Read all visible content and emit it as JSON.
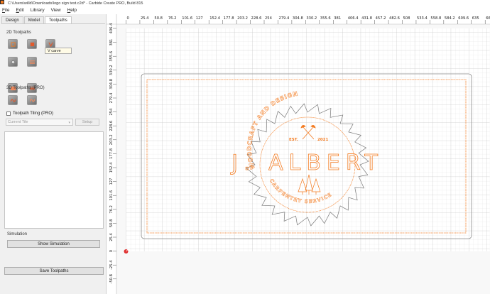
{
  "window": {
    "title": "C:\\Users\\willd\\Downloads\\logo sign test.c2d* - Carbide Create PRO, Build 815"
  },
  "menu": [
    {
      "key": "F",
      "rest": "ile"
    },
    {
      "key": "E",
      "rest": "dit"
    },
    {
      "key": "",
      "rest": "Library"
    },
    {
      "key": "",
      "rest": "View"
    },
    {
      "key": "H",
      "rest": "elp"
    }
  ],
  "tabs": [
    "Design",
    "Model",
    "Toolpaths"
  ],
  "active_tab": "Toolpaths",
  "sections": {
    "toolpaths_2d": "2D Toolpaths",
    "toolpaths_3d": "3D Toolpaths (PRO)"
  },
  "tooltip": "V carve",
  "tiling": {
    "label": "Toolpath Tiling (PRO)",
    "checked": false
  },
  "tile_select": {
    "value": "Current Tile"
  },
  "setup_label": "Setup",
  "simulation": {
    "label": "Simulation",
    "button": "Show Simulation"
  },
  "save_toolpaths": "Save Toolpaths",
  "icons": [
    "contour-icon",
    "pocket-icon",
    "vcarve-icon",
    "drill-icon",
    "texture-icon",
    "advanced-vcarve-icon",
    "chamfer-icon",
    "rough-3d-icon",
    "finish-3d-icon"
  ],
  "colors": {
    "accent": "#f47b20",
    "grid": "#d8d8d8",
    "ruler": "#ffffff"
  },
  "ruler": {
    "x_ticks": [
      "0",
      "25.4",
      "50.8",
      "76.2",
      "101.6",
      "127",
      "152.4",
      "177.8",
      "203.2",
      "228.6",
      "254",
      "279.4",
      "304.8",
      "330.2",
      "355.6",
      "381",
      "406.4",
      "431.8",
      "457.2",
      "482.6",
      "508",
      "533.4",
      "558.8",
      "584.2",
      "609.6",
      "635",
      "660"
    ],
    "y_ticks": [
      "406.4",
      "381",
      "355.6",
      "330.2",
      "304.8",
      "279.4",
      "254",
      "228.6",
      "203.2",
      "177.8",
      "152.4",
      "127",
      "101.6",
      "76.2",
      "50.8",
      "25.4",
      "0",
      "-25.4",
      "-50.8"
    ]
  },
  "design": {
    "arc_top": "WOODCRAFT AND DESIGN",
    "est": "EST.",
    "year": "2021",
    "name": "J. ALBERT",
    "arc_bottom": "CARPENTRY SERVICE"
  }
}
